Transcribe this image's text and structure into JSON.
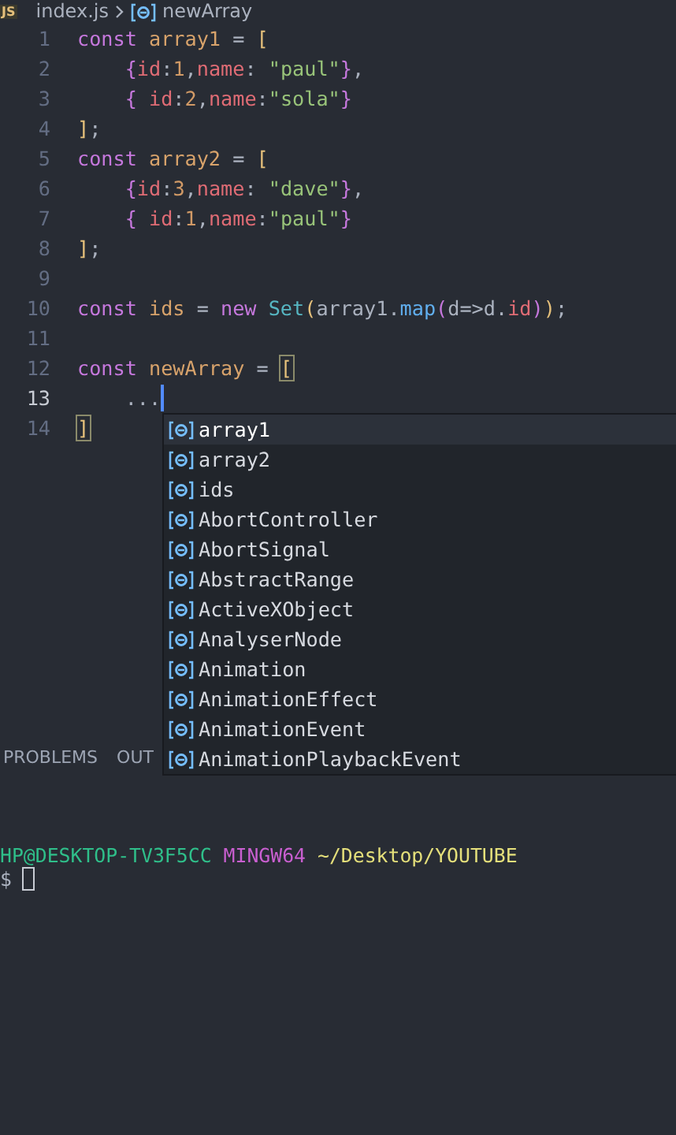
{
  "breadcrumb": {
    "file_badge": "JS",
    "file": "index.js",
    "symbol": "newArray"
  },
  "code_lines": [
    {
      "number": "1",
      "tokens": [
        {
          "text": "const ",
          "kind": "kw"
        },
        {
          "text": "array1",
          "kind": "var"
        },
        {
          "text": " = ",
          "kind": "op"
        },
        {
          "text": "[",
          "kind": "bracket"
        }
      ]
    },
    {
      "number": "2",
      "tokens": [
        {
          "text": "    {",
          "kind": "brace"
        },
        {
          "text": "id",
          "kind": "prop"
        },
        {
          "text": ":",
          "kind": "op"
        },
        {
          "text": "1",
          "kind": "num"
        },
        {
          "text": ",",
          "kind": "op"
        },
        {
          "text": "name",
          "kind": "prop"
        },
        {
          "text": ": ",
          "kind": "op"
        },
        {
          "text": "\"paul\"",
          "kind": "str"
        },
        {
          "text": "}",
          "kind": "brace"
        },
        {
          "text": ",",
          "kind": "op"
        }
      ]
    },
    {
      "number": "3",
      "tokens": [
        {
          "text": "    { ",
          "kind": "brace"
        },
        {
          "text": "id",
          "kind": "prop"
        },
        {
          "text": ":",
          "kind": "op"
        },
        {
          "text": "2",
          "kind": "num"
        },
        {
          "text": ",",
          "kind": "op"
        },
        {
          "text": "name",
          "kind": "prop"
        },
        {
          "text": ":",
          "kind": "op"
        },
        {
          "text": "\"sola\"",
          "kind": "str"
        },
        {
          "text": "}",
          "kind": "brace"
        }
      ]
    },
    {
      "number": "4",
      "tokens": [
        {
          "text": "]",
          "kind": "bracket"
        },
        {
          "text": ";",
          "kind": "op"
        }
      ]
    },
    {
      "number": "5",
      "tokens": [
        {
          "text": "const ",
          "kind": "kw"
        },
        {
          "text": "array2",
          "kind": "var"
        },
        {
          "text": " = ",
          "kind": "op"
        },
        {
          "text": "[",
          "kind": "bracket"
        }
      ]
    },
    {
      "number": "6",
      "tokens": [
        {
          "text": "    {",
          "kind": "brace"
        },
        {
          "text": "id",
          "kind": "prop"
        },
        {
          "text": ":",
          "kind": "op"
        },
        {
          "text": "3",
          "kind": "num"
        },
        {
          "text": ",",
          "kind": "op"
        },
        {
          "text": "name",
          "kind": "prop"
        },
        {
          "text": ": ",
          "kind": "op"
        },
        {
          "text": "\"dave\"",
          "kind": "str"
        },
        {
          "text": "}",
          "kind": "brace"
        },
        {
          "text": ",",
          "kind": "op"
        }
      ]
    },
    {
      "number": "7",
      "tokens": [
        {
          "text": "    { ",
          "kind": "brace"
        },
        {
          "text": "id",
          "kind": "prop"
        },
        {
          "text": ":",
          "kind": "op"
        },
        {
          "text": "1",
          "kind": "num"
        },
        {
          "text": ",",
          "kind": "op"
        },
        {
          "text": "name",
          "kind": "prop"
        },
        {
          "text": ":",
          "kind": "op"
        },
        {
          "text": "\"paul\"",
          "kind": "str"
        },
        {
          "text": "}",
          "kind": "brace"
        }
      ]
    },
    {
      "number": "8",
      "tokens": [
        {
          "text": "]",
          "kind": "bracket"
        },
        {
          "text": ";",
          "kind": "op"
        }
      ]
    },
    {
      "number": "9"
    },
    {
      "number": "10",
      "tokens": [
        {
          "text": "const ",
          "kind": "kw"
        },
        {
          "text": "ids",
          "kind": "var"
        },
        {
          "text": " = ",
          "kind": "op"
        },
        {
          "text": "new ",
          "kind": "kw"
        },
        {
          "text": "Set",
          "kind": "cls"
        },
        {
          "text": "(",
          "kind": "bracket"
        },
        {
          "text": "array1",
          "kind": "plain"
        },
        {
          "text": ".",
          "kind": "op"
        },
        {
          "text": "map",
          "kind": "func"
        },
        {
          "text": "(",
          "kind": "brace"
        },
        {
          "text": "d",
          "kind": "plain"
        },
        {
          "text": "=>",
          "kind": "op"
        },
        {
          "text": "d",
          "kind": "plain"
        },
        {
          "text": ".",
          "kind": "op"
        },
        {
          "text": "id",
          "kind": "prop"
        },
        {
          "text": ")",
          "kind": "brace"
        },
        {
          "text": ")",
          "kind": "bracket"
        },
        {
          "text": ";",
          "kind": "op"
        }
      ]
    },
    {
      "number": "11"
    },
    {
      "number": "12",
      "tokens": [
        {
          "text": "const ",
          "kind": "kw"
        },
        {
          "text": "newArray",
          "kind": "var"
        },
        {
          "text": " = ",
          "kind": "op"
        },
        {
          "text": "[",
          "kind": "bracket-match"
        }
      ]
    },
    {
      "number": "13",
      "tokens": [
        {
          "text": "    ...",
          "kind": "op"
        }
      ],
      "cursor": true
    },
    {
      "number": "14",
      "tokens": [
        {
          "text": "]",
          "kind": "bracket-match"
        }
      ]
    }
  ],
  "suggestions": [
    {
      "label": "array1",
      "selected": true
    },
    {
      "label": "array2",
      "selected": false
    },
    {
      "label": "ids",
      "selected": false
    },
    {
      "label": "AbortController",
      "selected": false
    },
    {
      "label": "AbortSignal",
      "selected": false
    },
    {
      "label": "AbstractRange",
      "selected": false
    },
    {
      "label": "ActiveXObject",
      "selected": false
    },
    {
      "label": "AnalyserNode",
      "selected": false
    },
    {
      "label": "Animation",
      "selected": false
    },
    {
      "label": "AnimationEffect",
      "selected": false
    },
    {
      "label": "AnimationEvent",
      "selected": false
    },
    {
      "label": "AnimationPlaybackEvent",
      "selected": false
    }
  ],
  "panel_tabs": [
    {
      "label": "PROBLEMS",
      "selected": false
    },
    {
      "label": "OUT",
      "selected": false
    }
  ],
  "terminal": {
    "prompt": [
      {
        "text": "HP@DESKTOP-TV3F5CC",
        "kind": "host"
      },
      {
        "text": "MINGW64",
        "kind": "env"
      },
      {
        "text": "~/Desktop/YOUTUBE",
        "kind": "path"
      }
    ],
    "symbol": "$"
  }
}
